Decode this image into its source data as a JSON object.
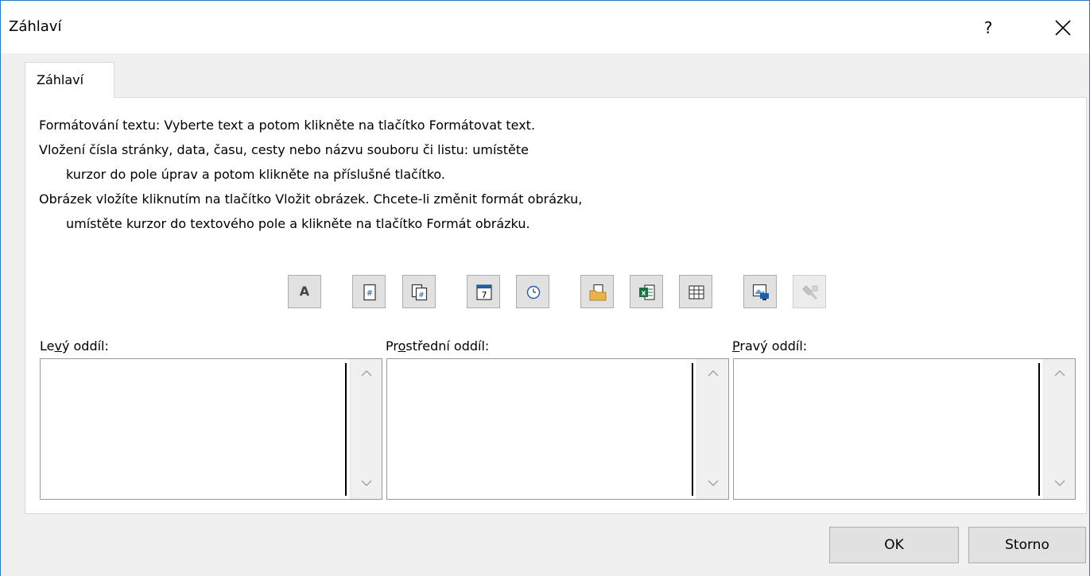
{
  "window": {
    "title": "Záhlaví",
    "help_label": "?",
    "close_icon": "close-icon"
  },
  "tab": {
    "label": "Záhlaví"
  },
  "instructions": [
    "Formátování textu: Vyberte text a potom klikněte na tlačítko Formátovat text.",
    "Vložení čísla stránky, data, času, cesty nebo názvu souboru či listu: umístěte",
    "kurzor do pole úprav a potom klikněte na příslušné tlačítko.",
    "Obrázek vložíte kliknutím na tlačítko Vložit obrázek. Chcete-li změnit formát obrázku,",
    "umístěte kurzor do textového pole a klikněte na tlačítko Formát obrázku."
  ],
  "toolbar": {
    "format_text_glyph": "A",
    "icons": [
      "format-text-icon",
      "page-number-icon",
      "number-of-pages-icon",
      "date-icon",
      "time-icon",
      "file-path-icon",
      "file-name-icon",
      "sheet-name-icon",
      "insert-picture-icon",
      "format-picture-icon"
    ]
  },
  "sections": {
    "left": {
      "label_pre": "Le",
      "label_u": "v",
      "label_post": "ý oddíl:",
      "value": ""
    },
    "center": {
      "label_pre": "Pr",
      "label_u": "o",
      "label_post": "střední oddíl:",
      "value": ""
    },
    "right": {
      "label_pre": "",
      "label_u": "P",
      "label_post": "ravý oddíl:",
      "value": ""
    }
  },
  "buttons": {
    "ok": "OK",
    "cancel": "Storno"
  },
  "colors": {
    "window_border": "#2b79c2",
    "dialog_bg": "#f0f0f0",
    "excel_green": "#1e7145",
    "folder_yellow": "#e8b44a"
  }
}
